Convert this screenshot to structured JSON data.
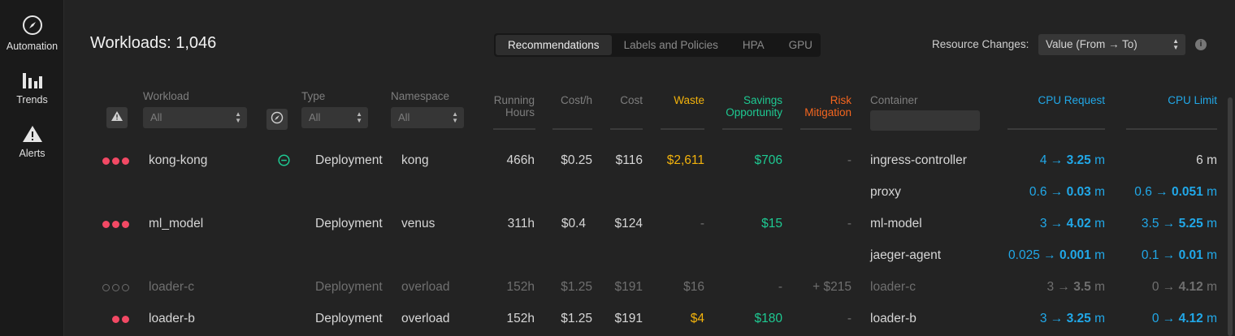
{
  "sidebar": {
    "items": [
      {
        "label": "Automation",
        "icon": "compass-icon"
      },
      {
        "label": "Trends",
        "icon": "bar-chart-icon"
      },
      {
        "label": "Alerts",
        "icon": "warning-icon"
      }
    ]
  },
  "header": {
    "title": "Workloads: 1,046",
    "tabs": [
      "Recommendations",
      "Labels and Policies",
      "HPA",
      "GPU"
    ],
    "active_tab": "Recommendations",
    "resource_changes_label": "Resource Changes:",
    "resource_changes_value": "Value (From → To)"
  },
  "columns": {
    "workload": "Workload",
    "type": "Type",
    "namespace": "Namespace",
    "running_hours": "Running Hours",
    "cost_per_hour": "Cost/h",
    "cost": "Cost",
    "waste": "Waste",
    "savings": "Savings Opportunity",
    "risk": "Risk Mitigation",
    "container": "Container",
    "cpu_request": "CPU Request",
    "cpu_limit": "CPU Limit"
  },
  "filters": {
    "workload": "All",
    "type": "All",
    "namespace": "All"
  },
  "colors": {
    "waste": "#f2b20c",
    "savings": "#1ec992",
    "risk": "#f5661f",
    "cpu": "#21a8e8",
    "severity": "#f24964"
  },
  "rows": [
    {
      "severity": 3,
      "workload": "kong-kong",
      "status_icon": "minus-circle-icon",
      "type": "Deployment",
      "namespace": "kong",
      "running_hours": "466h",
      "cost_h": "$0.25",
      "cost": "$116",
      "waste": "$2,611",
      "savings": "$706",
      "risk": "-",
      "container": "ingress-controller",
      "cpu_req_from": "4 →",
      "cpu_req_to": "3.25",
      "cpu_req_unit": "m",
      "cpu_limit_plain": "6 m"
    },
    {
      "severity": 0,
      "container": "proxy",
      "cpu_req_from": "0.6 →",
      "cpu_req_to": "0.03",
      "cpu_req_unit": "m",
      "cpu_lim_from": "0.6 →",
      "cpu_lim_to": "0.051",
      "cpu_lim_unit": "m"
    },
    {
      "severity": 3,
      "workload": "ml_model",
      "type": "Deployment",
      "namespace": "venus",
      "running_hours": "311h",
      "cost_h": "$0.4",
      "cost": "$124",
      "waste": "-",
      "savings": "$15",
      "risk": "-",
      "container": "ml-model",
      "cpu_req_from": "3 →",
      "cpu_req_to": "4.02",
      "cpu_req_unit": "m",
      "cpu_lim_from": "3.5 →",
      "cpu_lim_to": "5.25",
      "cpu_lim_unit": "m"
    },
    {
      "severity": 0,
      "container": "jaeger-agent",
      "cpu_req_from": "0.025 →",
      "cpu_req_to": "0.001",
      "cpu_req_unit": "m",
      "cpu_lim_from": "0.1 →",
      "cpu_lim_to": "0.01",
      "cpu_lim_unit": "m"
    },
    {
      "severity": 0,
      "workload": "loader-c",
      "type": "Deployment",
      "namespace": "overload",
      "running_hours": "152h",
      "cost_h": "$1.25",
      "cost": "$191",
      "waste": "$16",
      "savings": "-",
      "risk": "+ $215",
      "container": "loader-c",
      "cpu_req_from": "3 →",
      "cpu_req_to": "3.5",
      "cpu_req_unit": "m",
      "cpu_lim_from": "0 →",
      "cpu_lim_to": "4.12",
      "cpu_lim_unit": "m"
    },
    {
      "severity": 2,
      "workload": "loader-b",
      "type": "Deployment",
      "namespace": "overload",
      "running_hours": "152h",
      "cost_h": "$1.25",
      "cost": "$191",
      "waste": "$4",
      "savings": "$180",
      "risk": "-",
      "container": "loader-b",
      "cpu_req_from": "3 →",
      "cpu_req_to": "3.25",
      "cpu_req_unit": "m",
      "cpu_lim_from": "0 →",
      "cpu_lim_to": "4.12",
      "cpu_lim_unit": "m"
    }
  ]
}
